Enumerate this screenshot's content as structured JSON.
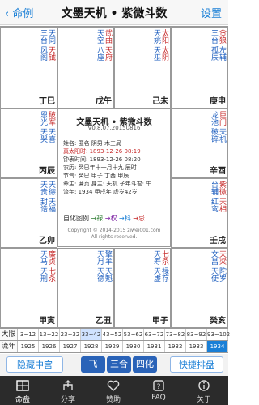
{
  "nav": {
    "back": "命例",
    "title": "文墨天机 • 紫微斗数",
    "settings": "设置"
  },
  "center": {
    "title": "文墨天机 • 紫微斗数",
    "version": "V0.8.07.20150816",
    "lines": [
      "姓名: 匿名          阴男 木三局",
      "真太阳时: 1893-12-26  08:19",
      "钟表时间: 1893-12-26  08:20",
      "农历: 癸巳年十一月十九 辰时",
      "节气: 癸巳  甲子  丁酉  甲辰",
      "命主: 廉贞 身主: 天机 子年斗君: 午",
      "流年: 1934 甲戌年  虚岁42岁"
    ],
    "legend_label": "自化图例",
    "legend": [
      "→禄",
      "→权",
      "→科",
      "→忌"
    ],
    "copy1": "Copyright © 2014-2015 ziwei001.com",
    "copy2": "All rights reserved."
  },
  "cells": [
    {
      "stars": [
        "天同",
        "天钺",
        "三台",
        "风阁"
      ],
      "tag": "",
      "ages": "",
      "palace": "丁巳",
      "pname": ""
    },
    {
      "stars": [
        "武曲",
        "天府",
        "天空",
        "八座"
      ],
      "tag": "",
      "ages": "",
      "palace": "戊午",
      "pname": ""
    },
    {
      "stars": [
        "太阳",
        "太阴",
        "天姚",
        "天巫"
      ],
      "tag": "",
      "ages": "",
      "palace": "己未",
      "pname": ""
    },
    {
      "stars": [
        "贪狼",
        "左辅",
        "三台",
        "孤辰"
      ],
      "tag": "",
      "ages": "",
      "palace": "庚申",
      "pname": ""
    },
    {
      "stars": [
        "破军",
        "天喜",
        "恩光",
        "天哭"
      ],
      "tag": "",
      "ages": "",
      "palace": "丙辰",
      "pname": ""
    },
    {
      "stars": [
        "巨门",
        "天机",
        "龙池",
        "破碎"
      ],
      "tag": "",
      "ages": "",
      "palace": "辛酉",
      "pname": ""
    },
    {
      "stars": [
        "天德",
        "天福",
        "天贵",
        "封诰"
      ],
      "tag": "",
      "ages": "",
      "palace": "乙卯",
      "pname": ""
    },
    {
      "stars": [
        "紫微",
        "天相",
        "台辅",
        "红鸾"
      ],
      "tag": "",
      "ages": "",
      "palace": "壬戌",
      "pname": ""
    },
    {
      "stars": [
        "廉贞",
        "七杀",
        "天马",
        "天刑"
      ],
      "tag": "",
      "ages": "",
      "palace": "甲寅",
      "pname": ""
    },
    {
      "stars": [
        "擎羊",
        "天魁",
        "天月",
        "天德"
      ],
      "tag": "",
      "ages": "",
      "palace": "乙丑",
      "pname": ""
    },
    {
      "stars": [
        "七杀",
        "禄存",
        "天寿",
        "天虚"
      ],
      "tag": "",
      "ages": "",
      "palace": "甲子",
      "pname": ""
    },
    {
      "stars": [
        "天梁",
        "陀罗",
        "文昌",
        "天使"
      ],
      "tag": "",
      "ages": "",
      "palace": "癸亥",
      "pname": ""
    }
  ],
  "daxian": {
    "label": "大限",
    "segments": [
      "3~12",
      "13~22",
      "23~32",
      "33~42",
      "43~52",
      "53~62",
      "63~72",
      "73~82",
      "83~92",
      "93~102"
    ],
    "selected_index": 3
  },
  "liunian": {
    "label": "流年",
    "years": [
      "1925",
      "1926",
      "1927",
      "1928",
      "1929",
      "1930",
      "1931",
      "1932",
      "1933",
      "1934"
    ],
    "current_index": 9
  },
  "actions": {
    "hide_center": "隐藏中宫",
    "fly": "飞",
    "sanhe": "三合",
    "sihua": "四化",
    "quick": "快捷排盘"
  },
  "tabs": [
    "命盘",
    "分享",
    "赞助",
    "FAQ",
    "关于"
  ],
  "colors": {
    "accent": "#1a7fd6",
    "red": "#c62828",
    "green": "#2e7d32",
    "tabbar": "#2b2b2b"
  }
}
